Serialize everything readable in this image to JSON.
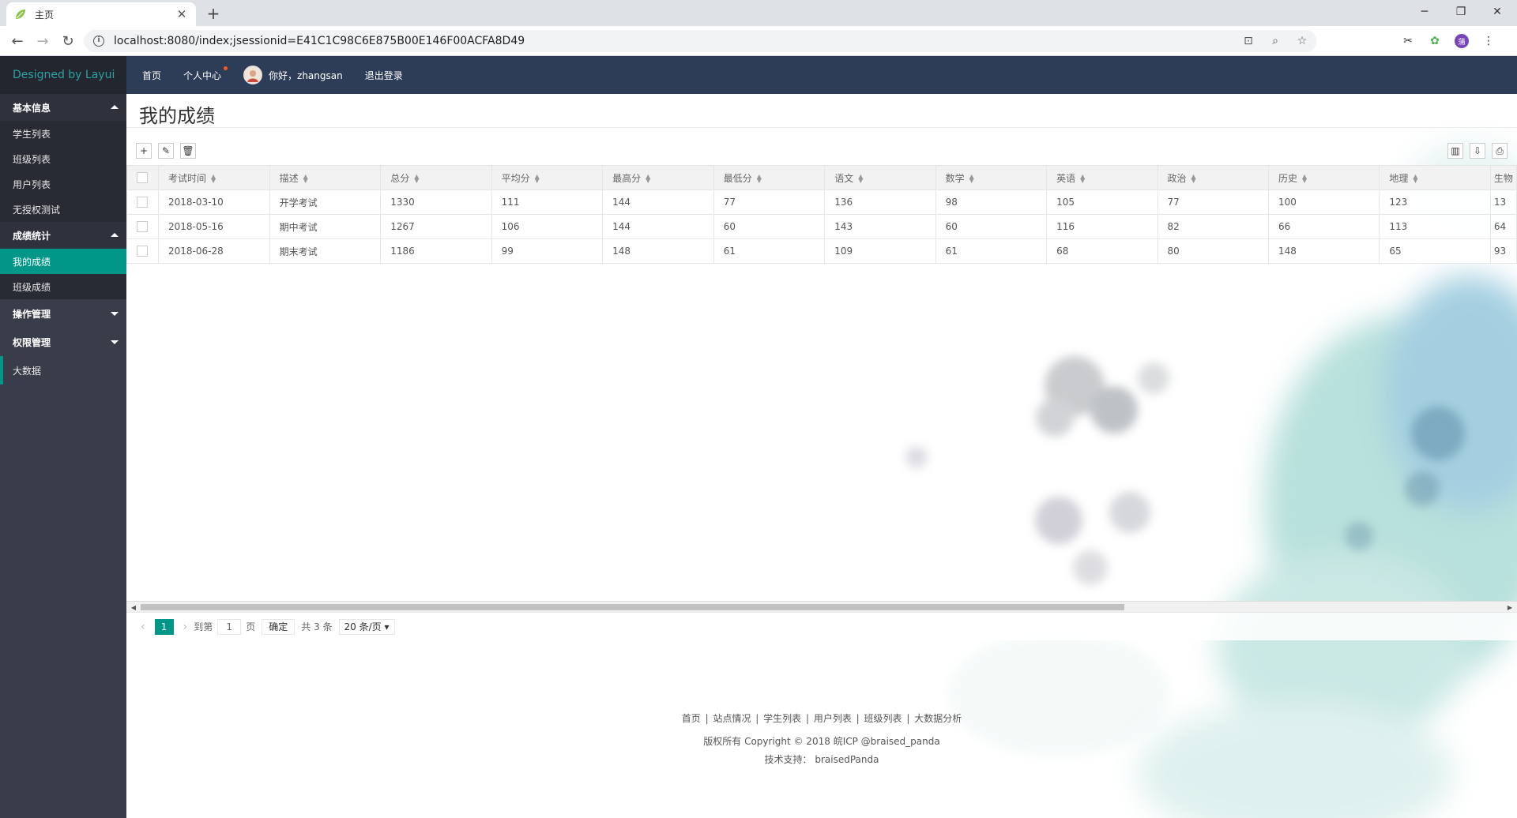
{
  "browser": {
    "tab_title": "主页",
    "url": "localhost:8080/index;jsessionid=E41C1C98C6E875B00E146F00ACFA8D49",
    "profile_initial": "蒲"
  },
  "header": {
    "logo": "Designed by Layui",
    "nav": [
      "首页",
      "个人中心"
    ],
    "greeting": "你好，zhangsan",
    "logout": "退出登录"
  },
  "sidebar": {
    "groups": [
      {
        "label": "基本信息",
        "items": [
          "学生列表",
          "班级列表",
          "用户列表",
          "无授权测试"
        ]
      },
      {
        "label": "成绩统计",
        "items": [
          "我的成绩",
          "班级成绩"
        ]
      },
      {
        "label": "操作管理",
        "items": []
      },
      {
        "label": "权限管理",
        "items": []
      }
    ],
    "single": "大数据"
  },
  "main": {
    "title": "我的成绩",
    "columns": [
      "考试时间",
      "描述",
      "总分",
      "平均分",
      "最高分",
      "最低分",
      "语文",
      "数学",
      "英语",
      "政治",
      "历史",
      "地理",
      "生物"
    ],
    "rows": [
      [
        "2018-03-10",
        "开学考试",
        "1330",
        "111",
        "144",
        "77",
        "136",
        "98",
        "105",
        "77",
        "100",
        "123",
        "13"
      ],
      [
        "2018-05-16",
        "期中考试",
        "1267",
        "106",
        "144",
        "60",
        "143",
        "60",
        "116",
        "82",
        "66",
        "113",
        "64"
      ],
      [
        "2018-06-28",
        "期末考试",
        "1186",
        "99",
        "148",
        "61",
        "109",
        "61",
        "68",
        "80",
        "148",
        "65",
        "93"
      ]
    ]
  },
  "pager": {
    "current": "1",
    "goto_label": "到第",
    "page_value": "1",
    "page_label": "页",
    "confirm": "确定",
    "total": "共 3 条",
    "per_page": "20 条/页"
  },
  "footer": {
    "links": [
      "首页",
      "站点情况",
      "学生列表",
      "用户列表",
      "班级列表",
      "大数据分析"
    ],
    "copyright": "版权所有 Copyright © 2018 皖ICP @braised_panda",
    "support": "技术支持：  braisedPanda"
  },
  "colors": {
    "accent": "#009688",
    "sidebar": "#393d49",
    "header": "#2e3d57",
    "logo": "#28a4a5"
  }
}
